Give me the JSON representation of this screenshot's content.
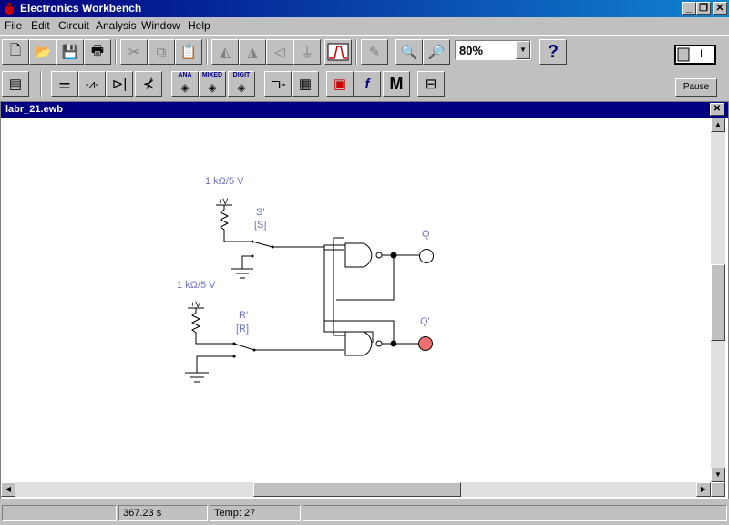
{
  "app": {
    "title": "Electronics Workbench"
  },
  "menu": [
    "File",
    "Edit",
    "Circuit",
    "Analysis",
    "Window",
    "Help"
  ],
  "toolbar": {
    "zoom_value": "80%",
    "help_label": "?",
    "pause_label": "Pause",
    "power_label": "I",
    "parts_tags": {
      "analog": "ANA",
      "mixed": "MIXED",
      "digital": "DIGIT",
      "misc": "M"
    }
  },
  "document": {
    "title": "labr_21.ewb"
  },
  "circuit": {
    "top_source_label": "1 kΩ/5 V",
    "bottom_source_label": "1 kΩ/5 V",
    "vcc_label": "+V",
    "switch_s_label": "S'",
    "switch_s_key": "[S]",
    "switch_r_label": "R'",
    "switch_r_key": "[R]",
    "output_q_label": "Q",
    "output_qbar_label": "Q'",
    "q_state": "off",
    "qbar_state": "on",
    "probe_on_color": "#f07070",
    "wire_label_color": "#7070c0"
  },
  "status": {
    "time": "367.23 s",
    "temp": "Temp:  27"
  }
}
